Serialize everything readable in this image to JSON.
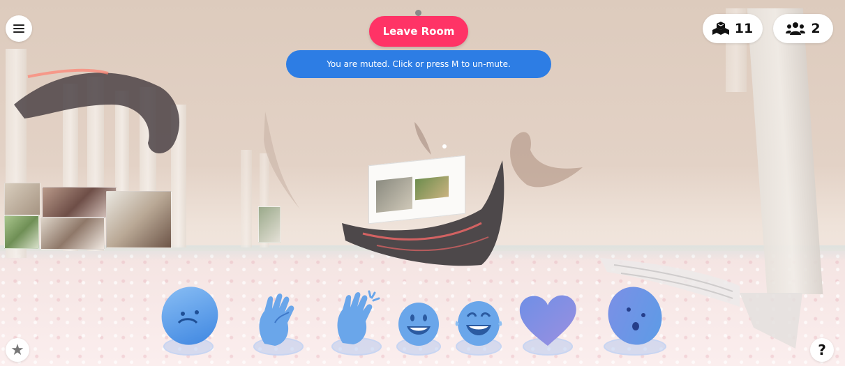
{
  "room": {
    "leave_label": "Leave Room",
    "mute_message": "You are muted. Click or press M to un-mute."
  },
  "counters": {
    "objects": "11",
    "people": "2"
  },
  "icons": {
    "menu": "hamburger-menu-icon",
    "objects": "cubes-icon",
    "people": "users-icon",
    "favorites": "star-icon",
    "help": "question-icon"
  },
  "help_label": "?",
  "reactions": [
    {
      "name": "sad",
      "icon": "sad-face-icon"
    },
    {
      "name": "clap",
      "icon": "clapping-hands-icon"
    },
    {
      "name": "applause",
      "icon": "applause-hands-icon"
    },
    {
      "name": "smile",
      "icon": "smile-face-icon"
    },
    {
      "name": "laugh",
      "icon": "laugh-face-icon"
    },
    {
      "name": "heart",
      "icon": "heart-icon"
    },
    {
      "name": "surprised",
      "icon": "surprised-face-icon"
    }
  ],
  "colors": {
    "leave": "#ff3366",
    "mute_bar": "#2d7de4",
    "reaction": "#5b9ce6"
  }
}
